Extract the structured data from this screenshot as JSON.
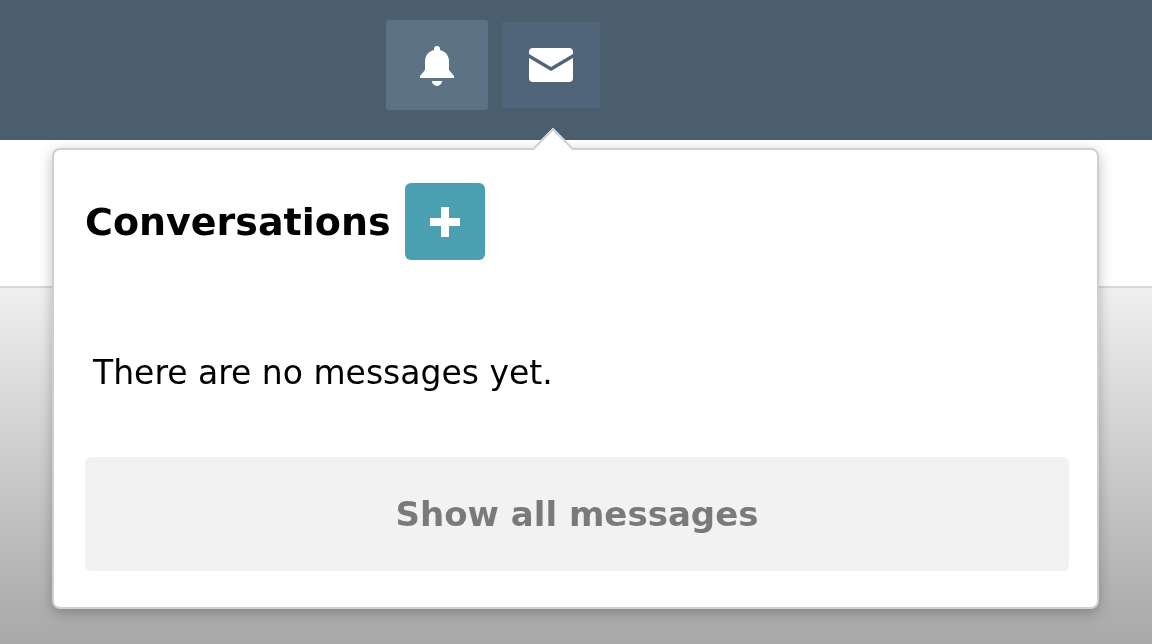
{
  "top_bar": {
    "buttons": [
      {
        "kind": "bell",
        "selected": false
      },
      {
        "kind": "mail",
        "selected": true
      }
    ]
  },
  "popover": {
    "title": "Conversations",
    "empty_message": "There are no messages yet.",
    "footer_button": "Show all messages"
  }
}
